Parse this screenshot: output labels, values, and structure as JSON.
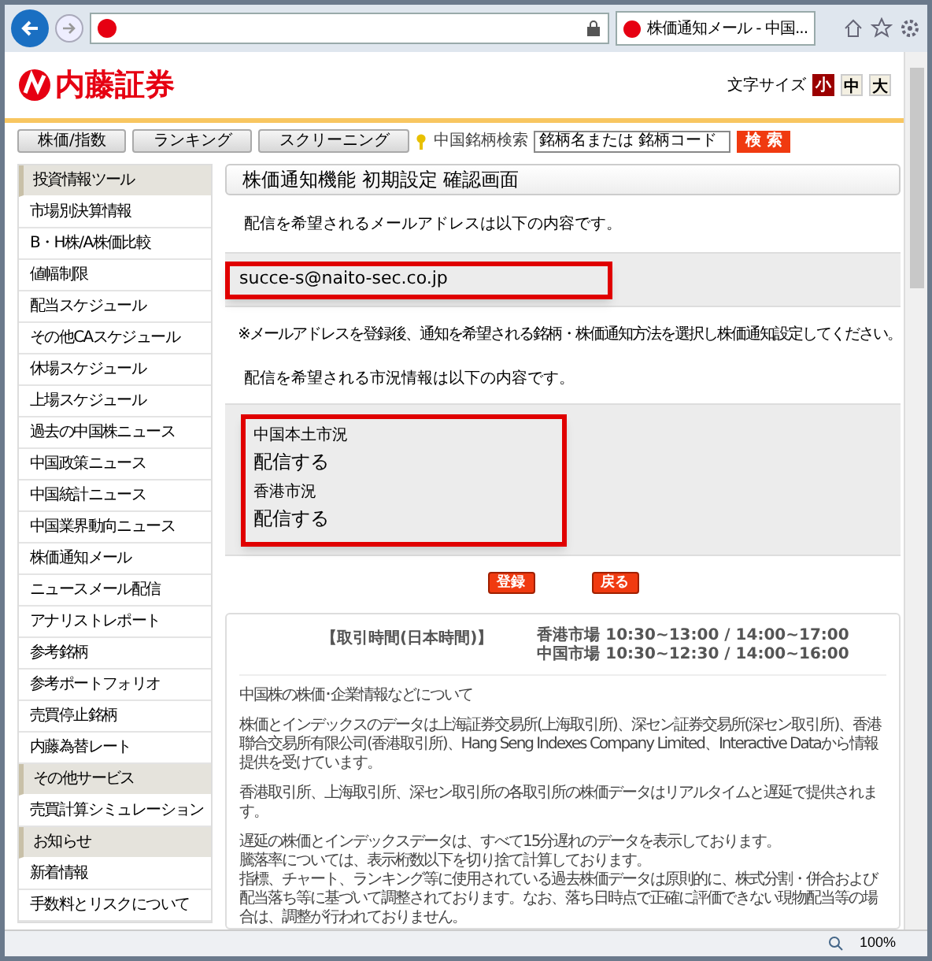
{
  "browser": {
    "tab_title": "株価通知メール - 中国...",
    "zoom": "100%"
  },
  "header": {
    "logo": "内藤証券",
    "font_size_label": "文字サイズ",
    "font_sizes": [
      {
        "label": "小",
        "selected": true
      },
      {
        "label": "中",
        "selected": false
      },
      {
        "label": "大",
        "selected": false
      }
    ]
  },
  "nav": {
    "buttons": [
      "株価/指数",
      "ランキング",
      "スクリーニング"
    ],
    "search_label": "中国銘柄検索",
    "search_value": "銘柄名または 銘柄コード",
    "search_button": "検 索"
  },
  "sidebar": {
    "items": [
      {
        "label": "投資情報ツール",
        "kind": "header"
      },
      {
        "label": "市場別決算情報",
        "kind": "link"
      },
      {
        "label": "B・H株/A株価比較",
        "kind": "link"
      },
      {
        "label": "値幅制限",
        "kind": "link"
      },
      {
        "label": "配当スケジュール",
        "kind": "link"
      },
      {
        "label": "その他CAスケジュール",
        "kind": "link"
      },
      {
        "label": "休場スケジュール",
        "kind": "link"
      },
      {
        "label": "上場スケジュール",
        "kind": "link"
      },
      {
        "label": "過去の中国株ニュース",
        "kind": "link"
      },
      {
        "label": "中国政策ニュース",
        "kind": "link"
      },
      {
        "label": "中国統計ニュース",
        "kind": "link"
      },
      {
        "label": "中国業界動向ニュース",
        "kind": "link"
      },
      {
        "label": "株価通知メール",
        "kind": "link"
      },
      {
        "label": "ニュースメール配信",
        "kind": "link"
      },
      {
        "label": "アナリストレポート",
        "kind": "link"
      },
      {
        "label": "参考銘柄",
        "kind": "link"
      },
      {
        "label": "参考ポートフォリオ",
        "kind": "link"
      },
      {
        "label": "売買停止銘柄",
        "kind": "link"
      },
      {
        "label": "内藤為替レート",
        "kind": "link"
      },
      {
        "label": "その他サービス",
        "kind": "header"
      },
      {
        "label": "売買計算シミュレーション",
        "kind": "link"
      },
      {
        "label": "お知らせ",
        "kind": "header"
      },
      {
        "label": "新着情報",
        "kind": "link"
      },
      {
        "label": "手数料とリスクについて",
        "kind": "link"
      }
    ]
  },
  "main": {
    "title": "株価通知機能 初期設定 確認画面",
    "email_intro": "配信を希望されるメールアドレスは以下の内容です。",
    "email": "succe-s@naito-sec.co.jp",
    "note": "※メールアドレスを登録後、通知を希望される銘柄・株価通知方法を選択し株価通知設定してください。",
    "market_intro": "配信を希望される市況情報は以下の内容です。",
    "markets": [
      {
        "name": "中国本土市況",
        "status": "配信する"
      },
      {
        "name": "香港市況",
        "status": "配信する"
      }
    ],
    "buttons": [
      "登録",
      "戻る"
    ],
    "trading_hours": {
      "label": "【取引時間(日本時間)】",
      "lines": [
        "香港市場 10:30~13:00 / 14:00~17:00",
        "中国市場 10:30~12:30 / 14:00~16:00"
      ]
    },
    "notice": [
      {
        "lines": [
          "中国株の株価･企業情報などについて"
        ]
      },
      {
        "lines": [
          "株価とインデックスのデータは上海証券交易所(上海取引所)、深セン証券交易所(深セン取引所)、香港聯合交易所有限公司(香港取引所)、Hang Seng Indexes Company Limited、Interactive Dataから情報提供を受けています。"
        ]
      },
      {
        "lines": [
          "香港取引所、上海取引所、深セン取引所の各取引所の株価データはリアルタイムと遅延で提供されます。"
        ]
      },
      {
        "lines": [
          "遅延の株価とインデックスデータは、すべて15分遅れのデータを表示しております。",
          "騰落率については、表示桁数以下を切り捨て計算しております。",
          "指標、チャート、ランキング等に使用されている過去株価データは原則的に、株式分割・併合および配当落ち等に基づいて調整されております。なお、落ち日時点で正確に評価できない現物配当等の場合は、調整が行われておりません。"
        ]
      }
    ]
  }
}
